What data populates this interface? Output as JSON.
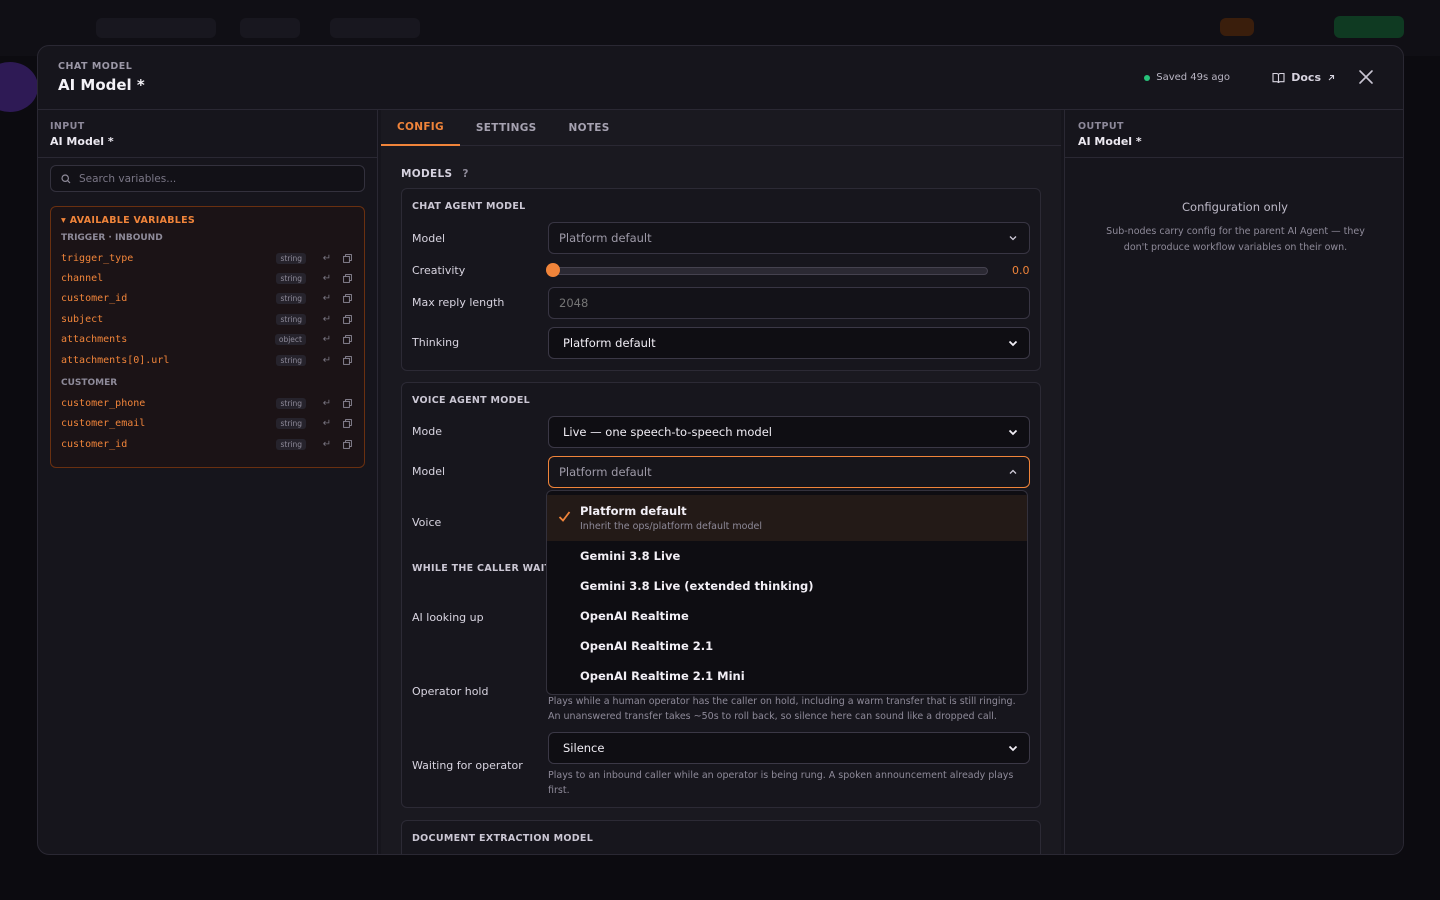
{
  "header": {
    "eyebrow": "CHAT MODEL",
    "title": "AI Model *",
    "saved_text": "Saved 49s ago",
    "docs_label": "Docs"
  },
  "input_panel": {
    "eyebrow": "INPUT",
    "title": "AI Model *",
    "search_placeholder": "Search variables...",
    "variables_title": "AVAILABLE VARIABLES",
    "groups": [
      {
        "label": "TRIGGER · INBOUND",
        "items": [
          {
            "name": "trigger_type",
            "type": "string"
          },
          {
            "name": "channel",
            "type": "string"
          },
          {
            "name": "customer_id",
            "type": "string"
          },
          {
            "name": "subject",
            "type": "string"
          },
          {
            "name": "attachments",
            "type": "object"
          },
          {
            "name": "attachments[0].url",
            "type": "string"
          }
        ]
      },
      {
        "label": "CUSTOMER",
        "items": [
          {
            "name": "customer_phone",
            "type": "string"
          },
          {
            "name": "customer_email",
            "type": "string"
          },
          {
            "name": "customer_id",
            "type": "string"
          }
        ]
      }
    ]
  },
  "tabs": [
    {
      "label": "CONFIG",
      "active": true
    },
    {
      "label": "SETTINGS",
      "active": false
    },
    {
      "label": "NOTES",
      "active": false
    }
  ],
  "models_label": "MODELS",
  "chat_agent": {
    "title": "CHAT AGENT MODEL",
    "model_label": "Model",
    "model_value": "Platform default",
    "creativity_label": "Creativity",
    "creativity_value": "0.0",
    "max_reply_label": "Max reply length",
    "max_reply_placeholder": "2048",
    "thinking_label": "Thinking",
    "thinking_value": "Platform default"
  },
  "voice_agent": {
    "title": "VOICE AGENT MODEL",
    "mode_label": "Mode",
    "mode_value": "Live — one speech-to-speech model",
    "model_label": "Model",
    "model_value": "Platform default",
    "voice_label": "Voice",
    "waits_title": "WHILE THE CALLER WAITS",
    "looking_up_label": "AI looking up",
    "operator_hold_label": "Operator hold",
    "operator_hold_hint": "Plays while a human operator has the caller on hold, including a warm transfer that is still ringing. An unanswered transfer takes ~50s to roll back, so silence here can sound like a dropped call.",
    "waiting_label": "Waiting for operator",
    "waiting_value": "Silence",
    "waiting_hint": "Plays to an inbound caller while an operator is being rung. A spoken announcement already plays first."
  },
  "doc_extraction_title": "DOCUMENT EXTRACTION MODEL",
  "dropdown": {
    "options": [
      {
        "label": "Platform default",
        "sub": "Inherit the ops/platform default model",
        "selected": true
      },
      {
        "label": "Gemini 3.8 Live",
        "sub": "",
        "selected": false
      },
      {
        "label": "Gemini 3.8 Live (extended thinking)",
        "sub": "",
        "selected": false
      },
      {
        "label": "OpenAI Realtime",
        "sub": "",
        "selected": false
      },
      {
        "label": "OpenAI Realtime 2.1",
        "sub": "",
        "selected": false
      },
      {
        "label": "OpenAI Realtime 2.1 Mini",
        "sub": "",
        "selected": false
      }
    ]
  },
  "output_panel": {
    "eyebrow": "OUTPUT",
    "title": "AI Model *",
    "config_title": "Configuration only",
    "config_sub": "Sub-nodes carry config for the parent AI Agent — they don't produce workflow variables on their own."
  },
  "colors": {
    "accent": "#f0843a",
    "status_ok": "#27c27a",
    "panel": "#16151c",
    "center": "#1a1920"
  }
}
